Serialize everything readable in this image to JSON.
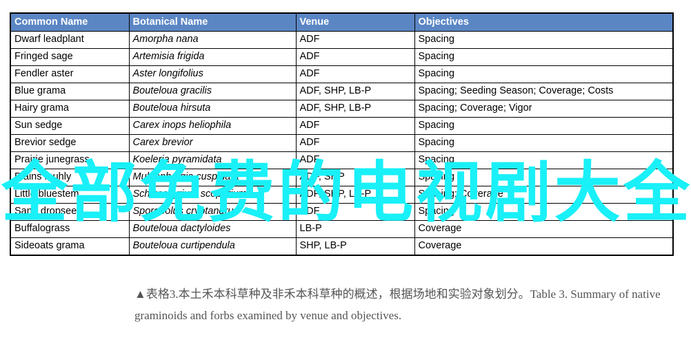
{
  "table": {
    "headers": [
      "Common Name",
      "Botanical  Name",
      "Venue",
      "Objectives"
    ],
    "header_bg": "#5B86C4",
    "header_color": "#FFFFFF",
    "rows": [
      {
        "common": "Dwarf leadplant",
        "botanical": "Amorpha nana",
        "venue": "ADF",
        "objectives": "Spacing"
      },
      {
        "common": "Fringed sage",
        "botanical": "Artemisia frigida",
        "venue": "ADF",
        "objectives": "Spacing"
      },
      {
        "common": "Fendler aster",
        "botanical": "Aster longifolius",
        "venue": "ADF",
        "objectives": "Spacing"
      },
      {
        "common": "Blue grama",
        "botanical": "Bouteloua gracilis",
        "venue": "ADF, SHP, LB-P",
        "objectives": "Spacing; Seeding Season;  Coverage; Costs"
      },
      {
        "common": "Hairy grama",
        "botanical": "Bouteloua hirsuta",
        "venue": "ADF, SHP, LB-P",
        "objectives": "Spacing; Coverage; Vigor"
      },
      {
        "common": "Sun sedge",
        "botanical": "Carex inops heliophila",
        "venue": "ADF",
        "objectives": "Spacing"
      },
      {
        "common": "Brevior sedge",
        "botanical": "Carex brevior",
        "venue": "ADF",
        "objectives": "Spacing"
      },
      {
        "common": "Prairie junegrass",
        "botanical": "Koeleria pyramidata",
        "venue": "ADF",
        "objectives": "Spacing"
      },
      {
        "common": "Plains muhly",
        "botanical": "Muhlenbergia cuspidata",
        "venue": "ADF, SHP",
        "objectives": "Spacing"
      },
      {
        "common": "Little bluestem",
        "botanical": "Schizachyrium scoparium",
        "venue": "ADF, SHP, LB-P",
        "objectives": "Spacing; Coverage"
      },
      {
        "common": "Sand dropseed",
        "botanical": "Sporobolus cryptandrus",
        "venue": "ADF",
        "objectives": "Spacing"
      },
      {
        "common": "Buffalograss",
        "botanical": "Bouteloua dactyloides",
        "venue": "LB-P",
        "objectives": "Coverage"
      },
      {
        "common": "Sideoats grama",
        "botanical": "Bouteloua curtipendula",
        "venue": "SHP, LB-P",
        "objectives": "Coverage"
      }
    ]
  },
  "caption": {
    "marker": "▲",
    "text": "表格3.本土禾本科草种及非禾本科草种的概述，根据场地和实验对象划分。Table 3. Summary of native graminoids and forbs examined by venue and objectives."
  },
  "overlay": {
    "color": "#19F0F7",
    "chars": [
      "全",
      "部",
      "免",
      "费",
      "的",
      "电",
      "视",
      "剧",
      "大",
      "全"
    ]
  }
}
